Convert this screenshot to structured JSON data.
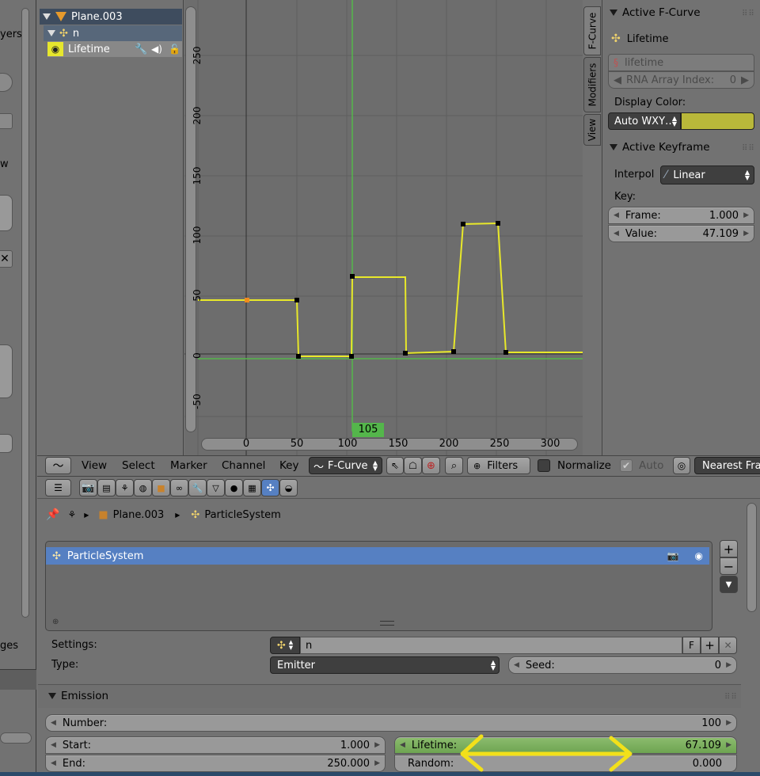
{
  "outliner": {
    "object": "Plane.003",
    "child": "n",
    "channel": "Lifetime"
  },
  "graph": {
    "y_ticks": [
      "250",
      "200",
      "150",
      "100",
      "50",
      "0",
      "-50"
    ],
    "x_ticks": [
      "0",
      "50",
      "100",
      "150",
      "200",
      "250",
      "300"
    ],
    "current_frame": "105",
    "curve_color": "#e8e82a"
  },
  "side_tabs": [
    "F-Curve",
    "Modifiers",
    "View"
  ],
  "fcurve_panel": {
    "title": "Active F-Curve",
    "curve_name": "Lifetime",
    "data_path": "lifetime",
    "array_index_label": "RNA Array Index:",
    "array_index_value": "0",
    "display_color_label": "Display Color:",
    "display_color_mode": "Auto WXY…",
    "display_color": "#b9b83a"
  },
  "keyframe_panel": {
    "title": "Active Keyframe",
    "interp_label": "Interpol",
    "interp_value": "Linear",
    "key_label": "Key:",
    "frame_label": "Frame:",
    "frame_value": "1.000",
    "value_label": "Value:",
    "value_value": "47.109"
  },
  "graph_header": {
    "menus": [
      "View",
      "Select",
      "Marker",
      "Channel",
      "Key"
    ],
    "mode": "F-Curve",
    "filters": "Filters",
    "normalize": "Normalize",
    "auto": "Auto",
    "snap": "Nearest Fra"
  },
  "properties": {
    "breadcrumb_object": "Plane.003",
    "breadcrumb_system": "ParticleSystem",
    "list_item": "ParticleSystem",
    "settings_label": "Settings:",
    "settings_value": "n",
    "settings_f": "F",
    "type_label": "Type:",
    "type_value": "Emitter",
    "seed_label": "Seed:",
    "seed_value": "0",
    "emission_title": "Emission",
    "number_label": "Number:",
    "number_value": "100",
    "start_label": "Start:",
    "start_value": "1.000",
    "end_label": "End:",
    "end_value": "250.000",
    "lifetime_label": "Lifetime:",
    "lifetime_value": "67.109",
    "random_label": "Random:",
    "random_value": "0.000"
  },
  "left_panel_fragments": [
    "yers",
    "w",
    "ges"
  ],
  "annotation_color": "#f2e01a"
}
